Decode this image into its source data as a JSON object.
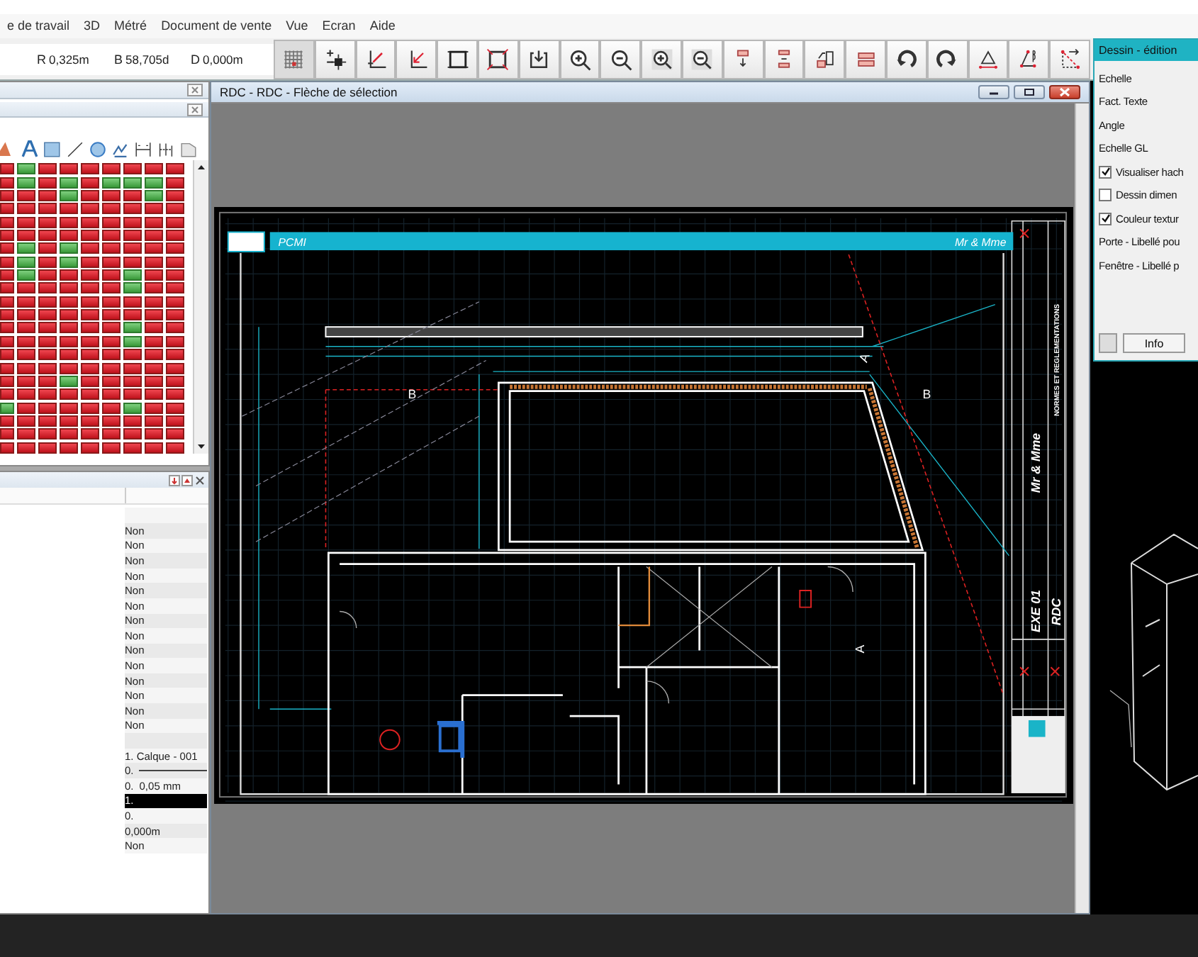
{
  "menu": [
    "e de travail",
    "3D",
    "Métré",
    "Document de vente",
    "Vue",
    "Ecran",
    "Aide"
  ],
  "coords": [
    {
      "label": "R",
      "value": "0,325m"
    },
    {
      "label": "B",
      "value": "58,705d"
    },
    {
      "label": "D",
      "value": "0,000m"
    }
  ],
  "layers": {
    "rows": [
      {
        "cells": [
          false,
          true,
          false,
          false,
          false,
          false,
          false,
          false,
          false
        ]
      },
      {
        "cells": [
          false,
          true,
          false,
          true,
          false,
          true,
          true,
          true,
          false
        ]
      },
      {
        "cells": [
          false,
          false,
          false,
          true,
          false,
          false,
          false,
          true,
          false
        ]
      },
      {
        "cells": [
          false,
          false,
          false,
          false,
          false,
          false,
          false,
          false,
          false
        ]
      },
      {
        "cells": [
          false,
          false,
          false,
          false,
          false,
          false,
          false,
          false,
          false
        ]
      },
      {
        "cells": [
          false,
          false,
          false,
          false,
          false,
          false,
          false,
          false,
          false
        ]
      },
      {
        "cells": [
          false,
          true,
          false,
          true,
          false,
          false,
          false,
          false,
          false
        ]
      },
      {
        "cells": [
          false,
          true,
          false,
          true,
          false,
          false,
          false,
          false,
          false
        ]
      },
      {
        "cells": [
          false,
          true,
          false,
          false,
          false,
          false,
          true,
          false,
          false
        ]
      },
      {
        "cells": [
          false,
          false,
          false,
          false,
          false,
          false,
          true,
          false,
          false
        ]
      },
      {
        "cells": [
          false,
          false,
          false,
          false,
          false,
          false,
          false,
          false,
          false
        ]
      },
      {
        "cells": [
          false,
          false,
          false,
          false,
          false,
          false,
          false,
          false,
          false
        ]
      },
      {
        "cells": [
          false,
          false,
          false,
          false,
          false,
          false,
          true,
          false,
          false
        ]
      },
      {
        "cells": [
          false,
          false,
          false,
          false,
          false,
          false,
          true,
          false,
          false
        ]
      },
      {
        "cells": [
          false,
          false,
          false,
          false,
          false,
          false,
          false,
          false,
          false
        ]
      },
      {
        "cells": [
          false,
          false,
          false,
          false,
          false,
          false,
          false,
          false,
          false
        ]
      },
      {
        "cells": [
          false,
          false,
          false,
          true,
          false,
          false,
          false,
          false,
          false
        ]
      },
      {
        "cells": [
          false,
          false,
          false,
          false,
          false,
          false,
          false,
          false,
          false
        ]
      },
      {
        "cells": [
          true,
          false,
          false,
          false,
          false,
          false,
          true,
          false,
          false
        ]
      },
      {
        "cells": [
          false,
          false,
          false,
          false,
          false,
          false,
          false,
          false,
          false
        ]
      },
      {
        "cells": [
          false,
          false,
          false,
          false,
          false,
          false,
          false,
          false,
          false
        ]
      },
      {
        "cells": [
          false,
          false,
          false,
          false,
          false,
          false,
          false,
          false,
          false
        ]
      }
    ]
  },
  "properties": {
    "rows": [
      {
        "kind": "blank",
        "selected": false
      },
      {
        "kind": "text",
        "value": "Non",
        "selected": false
      },
      {
        "kind": "text",
        "value": "Non",
        "selected": false
      },
      {
        "kind": "text",
        "value": "Non",
        "selected": false
      },
      {
        "kind": "text",
        "value": "Non",
        "selected": false
      },
      {
        "kind": "text",
        "value": "Non",
        "selected": false
      },
      {
        "kind": "text",
        "value": "Non",
        "selected": false
      },
      {
        "kind": "text",
        "value": "Non",
        "selected": false
      },
      {
        "kind": "text",
        "value": "Non",
        "selected": false
      },
      {
        "kind": "text",
        "value": "Non",
        "selected": false
      },
      {
        "kind": "text",
        "value": "Non",
        "selected": false
      },
      {
        "kind": "text",
        "value": "Non",
        "selected": false
      },
      {
        "kind": "text",
        "value": "Non",
        "selected": false
      },
      {
        "kind": "text",
        "value": "Non",
        "selected": false
      },
      {
        "kind": "text",
        "value": "Non",
        "selected": false
      },
      {
        "kind": "blank",
        "selected": false
      },
      {
        "kind": "text",
        "value": "1. Calque - 001",
        "selected": false
      },
      {
        "kind": "line",
        "value": "0.",
        "selected": false
      },
      {
        "kind": "pair",
        "value": "0.",
        "detail": "0,05 mm",
        "selected": false
      },
      {
        "kind": "text",
        "value": "1.",
        "selected": true
      },
      {
        "kind": "text",
        "value": "0.",
        "selected": false
      },
      {
        "kind": "text",
        "value": "0,000m",
        "selected": false
      },
      {
        "kind": "text",
        "value": "Non",
        "selected": false
      }
    ]
  },
  "drawing_window": {
    "title": "RDC - RDC - Flèche de sélection",
    "plan": {
      "banner_left": "PCMI",
      "banner_right": "Mr & Mme",
      "marks": [
        {
          "text": "B",
          "kind": "section"
        },
        {
          "text": "B",
          "kind": "section"
        },
        {
          "text": "A",
          "kind": "section"
        },
        {
          "text": "A",
          "kind": "section"
        }
      ],
      "title_block": [
        {
          "text": "Mr & Mme",
          "kind": "large"
        },
        {
          "text": "EXE 01",
          "kind": "large"
        },
        {
          "text": "RDC",
          "kind": "large"
        },
        {
          "text": "NORMES ET REGLEMENTATIONS",
          "kind": "small"
        }
      ]
    }
  },
  "dialog": {
    "title": "Dessin - édition",
    "items": [
      {
        "kind": "label",
        "text": "Echelle"
      },
      {
        "kind": "label",
        "text": "Fact. Texte"
      },
      {
        "kind": "label",
        "text": "Angle"
      },
      {
        "kind": "label",
        "text": "Echelle GL"
      },
      {
        "kind": "checkbox",
        "text": "Visualiser hach",
        "checked": true
      },
      {
        "kind": "checkbox",
        "text": "Dessin dimen",
        "checked": false
      },
      {
        "kind": "checkbox",
        "text": "Couleur textur",
        "checked": true
      },
      {
        "kind": "label",
        "text": "Porte - Libellé pou"
      },
      {
        "kind": "label",
        "text": "Fenêtre - Libellé p"
      }
    ],
    "button": "Info"
  }
}
